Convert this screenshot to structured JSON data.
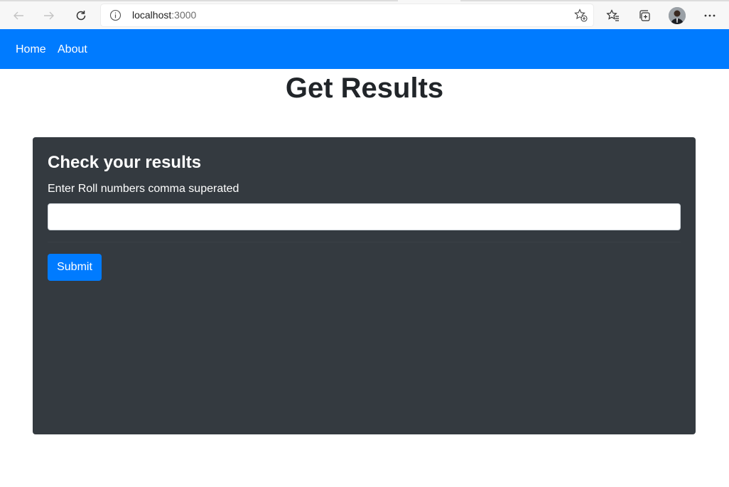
{
  "browser": {
    "url_host": "localhost",
    "url_port": ":3000"
  },
  "navbar": {
    "items": [
      {
        "label": "Home"
      },
      {
        "label": "About"
      }
    ],
    "background": "#007bff"
  },
  "page": {
    "title": "Get Results"
  },
  "card": {
    "title": "Check your results",
    "field_label": "Enter Roll numbers comma superated",
    "input_value": "",
    "input_placeholder": "",
    "submit_label": "Submit",
    "background": "#343a40"
  }
}
